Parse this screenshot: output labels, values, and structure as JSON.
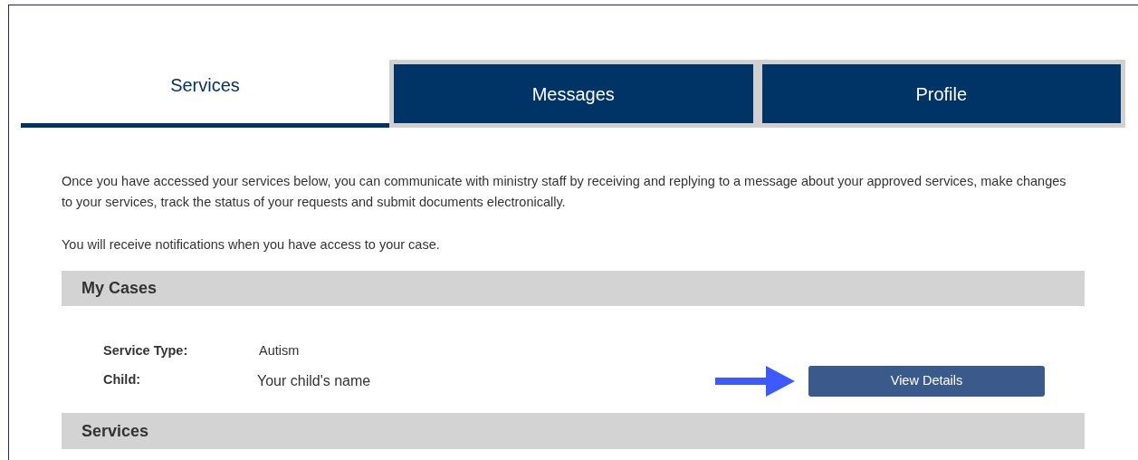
{
  "tabs": [
    {
      "label": "Services",
      "selected": true
    },
    {
      "label": "Messages",
      "selected": false
    },
    {
      "label": "Profile",
      "selected": false
    }
  ],
  "intro": [
    "Once you have accessed your services below, you can communicate with ministry staff by receiving and replying to a message about your approved services, make changes to your services, track the status of your requests and submit documents electronically.",
    "You will receive notifications when you have access to your case."
  ],
  "my_cases": {
    "title": "My Cases",
    "fields": [
      {
        "label": "Service Type:",
        "value": "Autism"
      },
      {
        "label": "Child:",
        "value": "Your child's name"
      }
    ],
    "button": "View Details"
  },
  "services": {
    "title": "Services"
  }
}
